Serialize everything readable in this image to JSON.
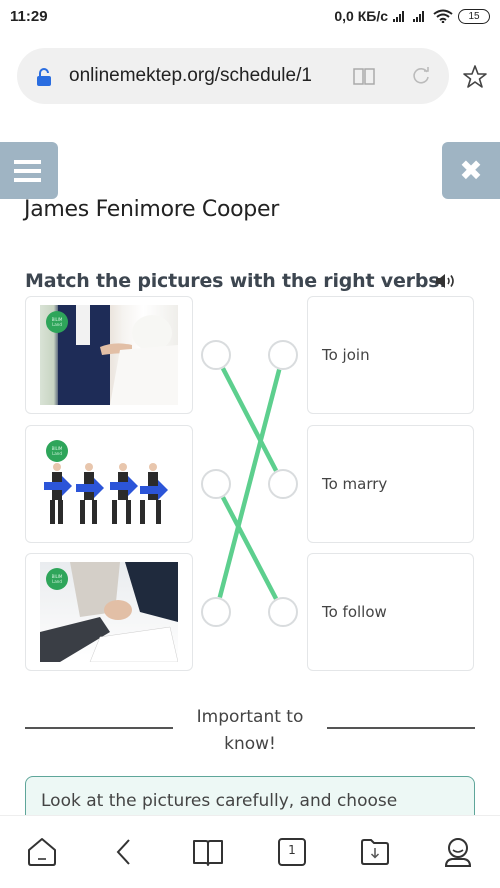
{
  "status_bar": {
    "time": "11:29",
    "network_speed": "0,0 КБ/с",
    "battery": "15",
    "icons": [
      "signal-icon",
      "signal-icon",
      "wifi-icon",
      "battery-icon"
    ]
  },
  "browser": {
    "url": "onlinemektep.org/schedule/1",
    "icons": [
      "lock-icon",
      "reader-mode-icon",
      "reload-icon",
      "bookmark-star-icon"
    ]
  },
  "lesson": {
    "menu_icon": "hamburger-menu-icon",
    "close_icon": "close-icon",
    "close_glyph": "✖",
    "title": "James Fenimore Cooper"
  },
  "task": {
    "title": "Match the pictures with the right verbs.",
    "audio_icon": "speaker-icon",
    "pictures": [
      {
        "description": "wedding ring exchange",
        "badge": "BILIM Land"
      },
      {
        "description": "men carrying arrows walking in a line",
        "badge": "BILIM Land"
      },
      {
        "description": "business handshake",
        "badge": "BILIM Land"
      }
    ],
    "verbs": [
      {
        "label": "To join"
      },
      {
        "label": "To marry"
      },
      {
        "label": "To follow"
      }
    ],
    "matches": [
      {
        "picture": 0,
        "verb": 1
      },
      {
        "picture": 1,
        "verb": 2
      },
      {
        "picture": 2,
        "verb": 0
      }
    ],
    "line_color": "#5dcf8e"
  },
  "important": {
    "label": "Important to know!",
    "hint": "Look at the pictures carefully, and choose"
  },
  "bottom_nav": {
    "items": [
      {
        "name": "home-icon"
      },
      {
        "name": "back-icon"
      },
      {
        "name": "bookmarks-icon"
      },
      {
        "name": "tabs-icon",
        "count": "1"
      },
      {
        "name": "downloads-icon"
      },
      {
        "name": "profile-icon"
      }
    ]
  }
}
